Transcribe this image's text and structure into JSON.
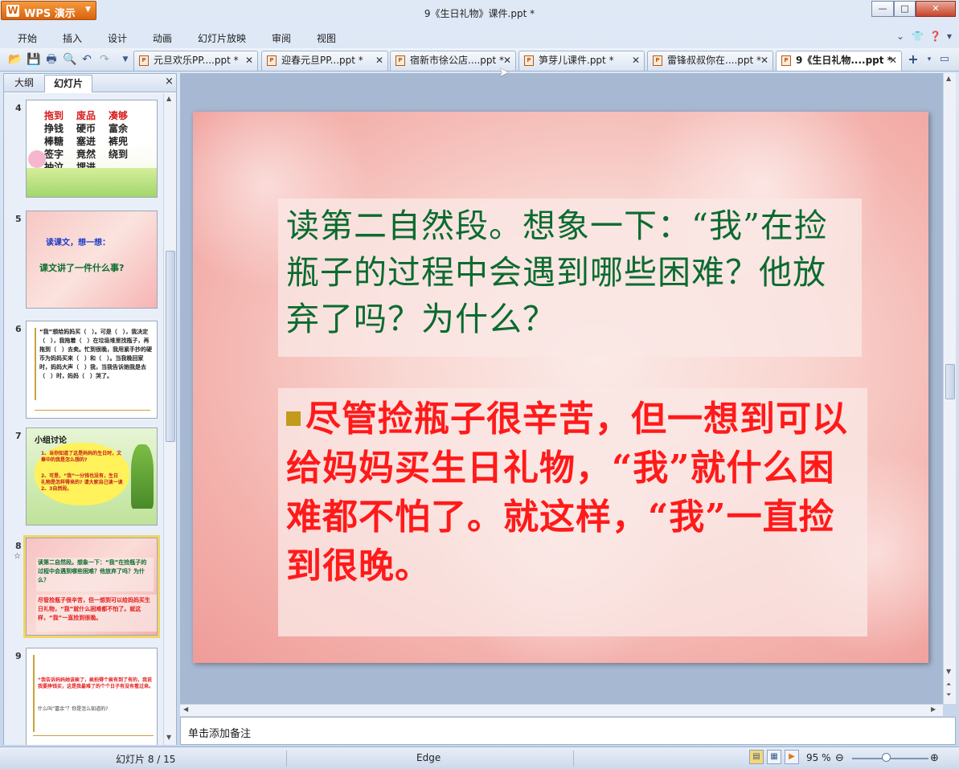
{
  "app": {
    "button_label": "WPS 演示",
    "window_title": "9《生日礼物》课件.ppt *"
  },
  "window_controls": {
    "minimize": "—",
    "maximize": "□",
    "close": "✕"
  },
  "menu": [
    "开始",
    "插入",
    "设计",
    "动画",
    "幻灯片放映",
    "审阅",
    "视图"
  ],
  "doc_tabs": [
    {
      "label": "元旦欢乐PP....ppt *",
      "active": false
    },
    {
      "label": "迎春元旦PP...ppt *",
      "active": false
    },
    {
      "label": "宿新市徐公店....ppt *",
      "active": false
    },
    {
      "label": "笋芽儿课件.ppt *",
      "active": false
    },
    {
      "label": "雷锋叔叔你在....ppt *",
      "active": false
    },
    {
      "label": "9《生日礼物....ppt *",
      "active": true
    }
  ],
  "left_pane": {
    "tab_outline": "大纲",
    "tab_slides": "幻灯片",
    "close": "×"
  },
  "thumbnails": [
    {
      "num": "4",
      "words": [
        "拖到",
        "废品",
        "凑够",
        "挣钱",
        "硬币",
        "富余",
        "棒糖",
        "塞进",
        "裤兜",
        "签字",
        "竟然",
        "绕到",
        "抽泣",
        "埋进"
      ]
    },
    {
      "num": "5",
      "line1": "读课文，想一想：",
      "line2": "课文讲了一件什么事?"
    },
    {
      "num": "6",
      "text": "“我”想给妈妈买（　）。可是（　），我决定（　），我拖着（　）在垃圾堆里找瓶子，再拖到（　）去卖。忙到很晚，我用紧手抄的硬币为妈妈买来（　）和（　）。当我晚回家时，妈妈大声（　）我，当我告诉她我是去（　）时，妈妈（　）哭了。"
    },
    {
      "num": "7",
      "title": "小组讨论",
      "item1": "1、当你知道了这是妈妈的生日时，文章中的我是怎么想的?",
      "item2": "2、可是，“我”一分钱也没有，生日礼物是怎样得来的? 请大家自己读一读2、3自然段。"
    },
    {
      "num": "8",
      "q": "读第二自然段。想象一下：“我”在捡瓶子的过程中会遇到哪些困难？他放弃了吗？为什么？",
      "a": "尽管捡瓶子很辛苦，但一想到可以给妈妈买生日礼物，“我”就什么困难都不怕了。就这样，“我”一直捡到很晚。"
    },
    {
      "num": "9",
      "line1": "“我告诉妈妈她该挨了，挨拍得个挨有到了有的，我说我要挣钱买，这是我最难了的个个日子有没有看过来。",
      "line2": "什么叫“富余”？你是怎么知道的?"
    }
  ],
  "slide": {
    "question": "读第二自然段。想象一下：“我”在捡瓶子的过程中会遇到哪些困难？他放弃了吗？为什么？",
    "answer": "尽管捡瓶子很辛苦，但一想到可以给妈妈买生日礼物，“我”就什么困难都不怕了。就这样，“我”一直捡到很晚。"
  },
  "notes_placeholder": "单击添加备注",
  "status": {
    "slide_pos": "幻灯片 8 / 15",
    "theme": "Edge",
    "zoom": "95 %"
  },
  "colors": {
    "question": "#0b6b2f",
    "answer": "#ff1a1a",
    "bullet": "#c29a1c",
    "wps_orange": "#e8781e"
  }
}
